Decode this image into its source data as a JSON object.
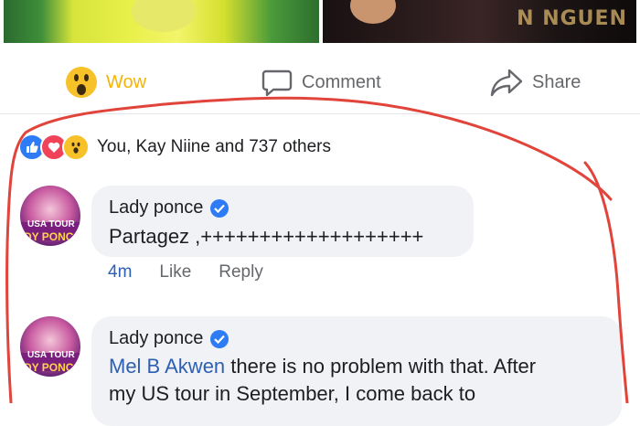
{
  "photos": {
    "right_overlay_text": "N NGUEN"
  },
  "actions": {
    "wow_label": "Wow",
    "comment_label": "Comment",
    "share_label": "Share"
  },
  "reactions": {
    "summary": "You, Kay Niine and 737 others"
  },
  "comments": [
    {
      "author": "Lady ponce",
      "text": "Partagez ,+++++++++++++++++++",
      "time": "4m",
      "like_label": "Like",
      "reply_label": "Reply",
      "avatar_text_1": "USA TOUR",
      "avatar_text_2": "DY PONC"
    },
    {
      "author": "Lady ponce",
      "mention": "Mel B Akwen",
      "text_line1_rest": " there is no problem with that. After",
      "text_line2": "my US tour in September, I come back to",
      "avatar_text_1": "USA TOUR",
      "avatar_text_2": "DY PONC"
    }
  ],
  "colors": {
    "accent_blue": "#2d7cf6",
    "wow_yellow": "#f5b40b",
    "annotation_red": "#e0443a"
  }
}
